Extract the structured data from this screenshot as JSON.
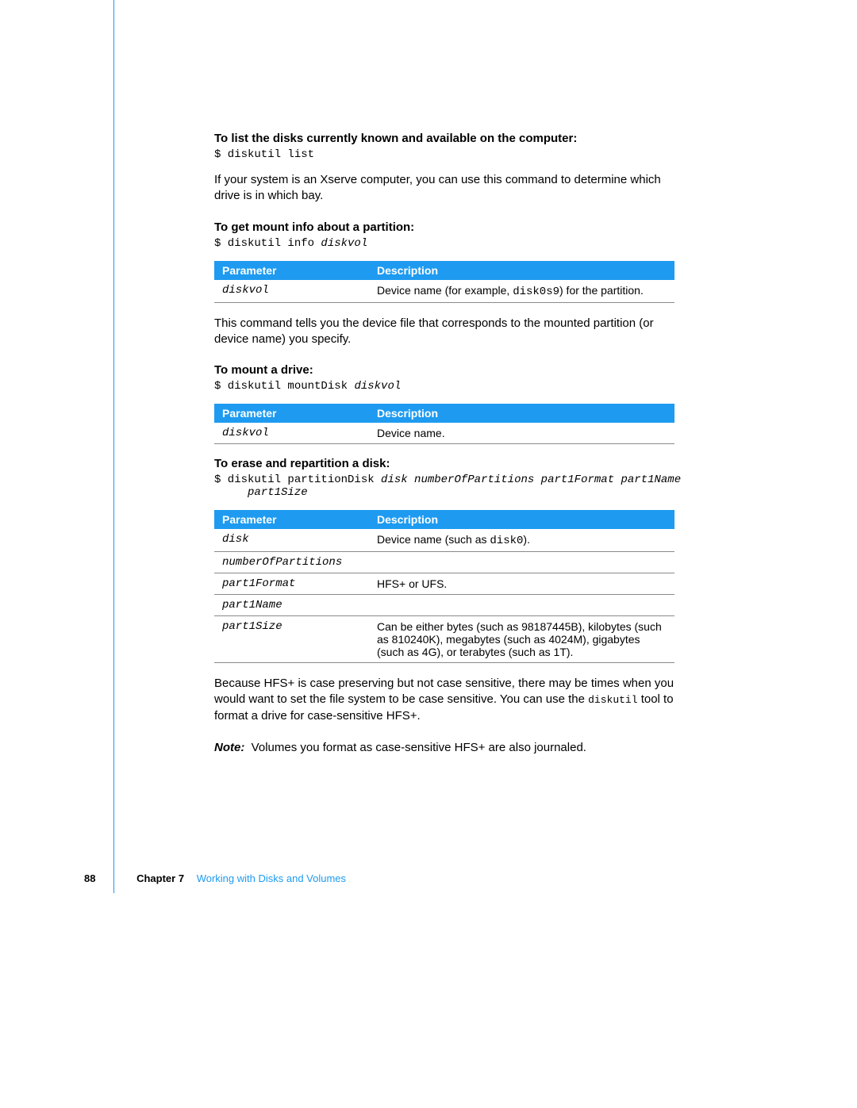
{
  "sections": {
    "listDisks": {
      "heading": "To list the disks currently known and available on the computer:",
      "cmd": "$ diskutil list",
      "body": "If your system is an Xserve computer, you can use this command to determine which drive is in which bay."
    },
    "mountInfo": {
      "heading": "To get mount info about a partition:",
      "cmdPrefix": "$ diskutil info ",
      "cmdArg": "diskvol",
      "tableHead": {
        "p": "Parameter",
        "d": "Description"
      },
      "row": {
        "param": "diskvol",
        "descPre": "Device name (for example, ",
        "descCode": "disk0s9",
        "descPost": ") for the partition."
      },
      "body": "This command tells you the device file that corresponds to the mounted partition (or device name) you specify."
    },
    "mountDrive": {
      "heading": "To mount a drive:",
      "cmdPrefix": "$ diskutil mountDisk ",
      "cmdArg": "diskvol",
      "tableHead": {
        "p": "Parameter",
        "d": "Description"
      },
      "row": {
        "param": "diskvol",
        "desc": "Device name."
      }
    },
    "erase": {
      "heading": "To erase and repartition a disk:",
      "cmdPrefix": "$ diskutil partitionDisk ",
      "cmdArgs": "disk numberOfPartitions part1Format part1Name",
      "cmdLine2Indent": "     ",
      "cmdLine2": "part1Size",
      "tableHead": {
        "p": "Parameter",
        "d": "Description"
      },
      "rows": [
        {
          "param": "disk",
          "descPre": "Device name (such as ",
          "descCode": "disk0",
          "descPost": ")."
        },
        {
          "param": "numberOfPartitions",
          "desc": ""
        },
        {
          "param": "part1Format",
          "desc": "HFS+ or UFS."
        },
        {
          "param": "part1Name",
          "desc": ""
        },
        {
          "param": "part1Size",
          "desc": "Can be either bytes (such as 98187445B), kilobytes (such as 810240K), megabytes (such as 4024M), gigabytes (such as 4G), or terabytes (such as 1T)."
        }
      ],
      "bodyPre": "Because HFS+ is case preserving but not case sensitive, there may be times when you would want to set the file system to be case sensitive. You can use the ",
      "bodyCode": "diskutil",
      "bodyPost": " tool to format a drive for case-sensitive HFS+.",
      "noteLabel": "Note:",
      "noteBody": "Volumes you format as case-sensitive HFS+ are also journaled."
    }
  },
  "footer": {
    "page": "88",
    "chapter": "Chapter 7",
    "title": "Working with Disks and Volumes"
  }
}
